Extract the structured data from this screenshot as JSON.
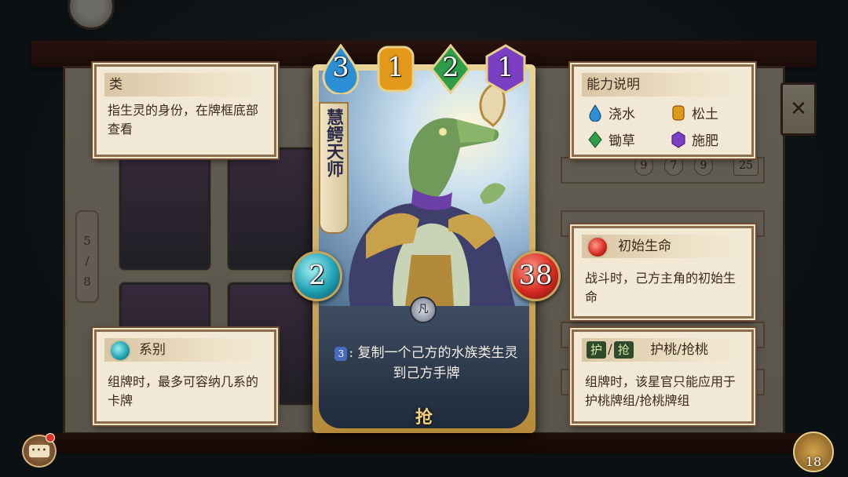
{
  "type_panel": {
    "title": "类",
    "body": "指生灵的身份，在牌框底部查看"
  },
  "series_panel": {
    "title": "系别",
    "body": "组牌时，最多可容纳几系的卡牌"
  },
  "ability_panel": {
    "title": "能力说明",
    "items": [
      {
        "label": "浇水",
        "color": "#2c8fd6",
        "icon": "water-drop-icon"
      },
      {
        "label": "松土",
        "color": "#e39a1a",
        "icon": "soil-gem-icon"
      },
      {
        "label": "锄草",
        "color": "#2f9e4a",
        "icon": "hoe-gem-icon"
      },
      {
        "label": "施肥",
        "color": "#7a3fc2",
        "icon": "fertilize-gem-icon"
      }
    ]
  },
  "life_panel": {
    "title": "初始生命",
    "body": "战斗时，己方主角的初始生命"
  },
  "peach_panel": {
    "tag1": "护",
    "tag2": "抢",
    "title": "护桃/抢桃",
    "body": "组牌时，该星官只能应用于护桃牌组/抢桃牌组"
  },
  "card": {
    "name": "慧鳄天师",
    "costs": [
      {
        "value": "3",
        "color": "#2c8fd6"
      },
      {
        "value": "1",
        "color": "#e39a1a"
      },
      {
        "value": "2",
        "color": "#2f9e4a"
      },
      {
        "value": "1",
        "color": "#7a3fc2"
      }
    ],
    "series_value": "2",
    "life_value": "38",
    "emblem": "凡",
    "desc_cost": "3",
    "desc": ": 复制一个己方的水族类生灵到己方手牌",
    "grab": "抢"
  },
  "background": {
    "page_indicator": {
      "current": "5",
      "total": "8"
    },
    "cost_row": [
      "9",
      "7",
      "9",
      "25"
    ]
  },
  "hud": {
    "coin_count": "18",
    "chat_label": "•••"
  }
}
